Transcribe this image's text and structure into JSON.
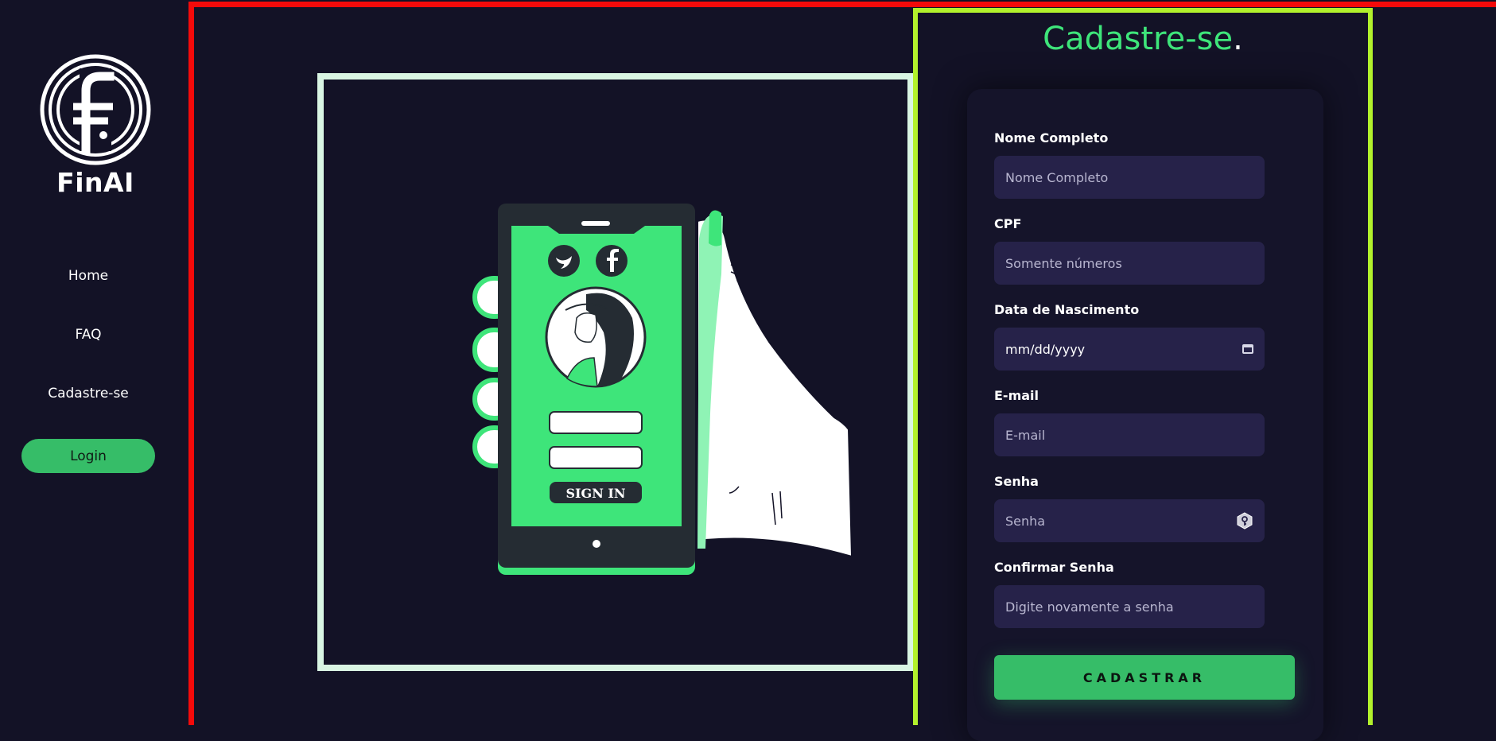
{
  "sidebar": {
    "logo_text": "FinAI",
    "nav": [
      {
        "label": "Home"
      },
      {
        "label": "FAQ"
      },
      {
        "label": "Cadastre-se"
      }
    ],
    "login_label": "Login"
  },
  "illustration": {
    "sign_in_label": "SIGN IN"
  },
  "form": {
    "title": "Cadastre-se",
    "title_dot": ".",
    "fields": [
      {
        "label": "Nome Completo",
        "placeholder": "Nome Completo"
      },
      {
        "label": "CPF",
        "placeholder": "Somente números"
      },
      {
        "label": "Data de Nascimento",
        "placeholder": "mm/dd/yyyy"
      },
      {
        "label": "E-mail",
        "placeholder": "E-mail"
      },
      {
        "label": "Senha",
        "placeholder": "Senha"
      },
      {
        "label": "Confirmar Senha",
        "placeholder": "Digite novamente a senha"
      }
    ],
    "submit_label": "CADASTRAR"
  },
  "colors": {
    "background": "#131226",
    "accent_green": "#36bd68",
    "title_green": "#3ee57a",
    "frame_red": "#f40a0a",
    "frame_lime": "#b2f12c",
    "input_bg": "#262249"
  },
  "icons": [
    "finai-logo-icon",
    "twitter-icon",
    "facebook-icon",
    "calendar-icon",
    "key-icon"
  ]
}
